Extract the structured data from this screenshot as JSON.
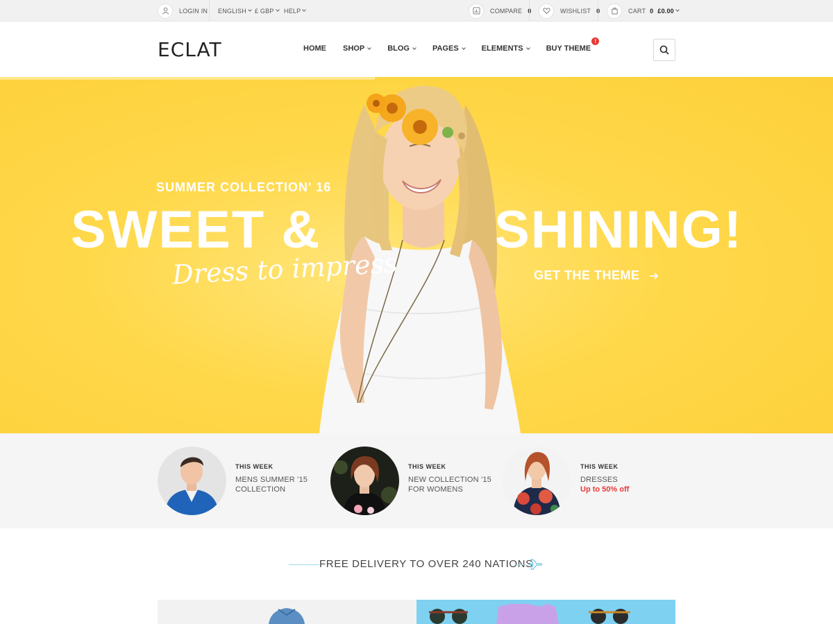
{
  "topbar": {
    "login": "LOGIN IN",
    "language": "ENGLISH",
    "currency": "£ GBP",
    "help": "HELP",
    "compare_label": "COMPARE",
    "compare_count": "0",
    "wishlist_label": "WISHLIST",
    "wishlist_count": "0",
    "cart_label": "CART",
    "cart_count": "0",
    "cart_total": "£0.00"
  },
  "header": {
    "logo": "ECLAT",
    "nav": [
      "HOME",
      "SHOP",
      "BLOG",
      "PAGES",
      "ELEMENTS",
      "BUY THEME"
    ],
    "badge": "!"
  },
  "hero": {
    "subtitle": "SUMMER COLLECTION' 16",
    "title_left": "SWEET &",
    "title_right": "SHINING!",
    "script": "Dress to impress",
    "cta": "GET THE THEME",
    "bg_color": "#fdd43f"
  },
  "promos": [
    {
      "kicker": "THIS WEEK",
      "line1": "MENS SUMMER '15",
      "line2": "COLLECTION",
      "sale": ""
    },
    {
      "kicker": "THIS WEEK",
      "line1": "NEW COLLECTION '15",
      "line2": "FOR WOMENS",
      "sale": ""
    },
    {
      "kicker": "THIS WEEK",
      "line1": "DRESSES",
      "line2": "",
      "sale": "Up to 50% off"
    }
  ],
  "delivery": {
    "text": "FREE DELIVERY TO OVER 240 NATIONS"
  },
  "colors": {
    "accent_red": "#e53935",
    "delivery_line": "#9cd8ea",
    "banner_blue": "#7fd1f1"
  }
}
